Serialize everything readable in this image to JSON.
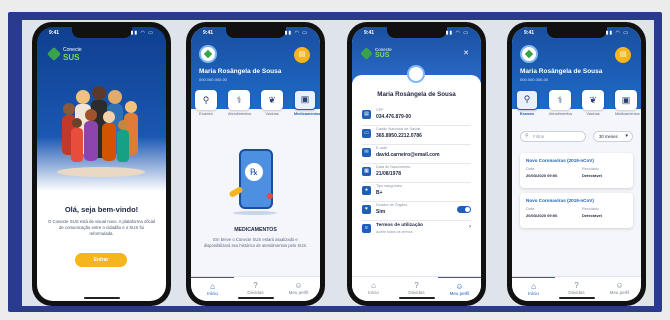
{
  "status_time": "9:41",
  "phone1": {
    "logo_line1": "Conecte",
    "logo_line2": "SUS",
    "welcome": "Olá, seja bem-vindo!",
    "message": "O Conecte SUS está de visual novo. A plataforma oficial de comunicação entre o cidadão e o SUS foi reformulada.",
    "button": "Entrar"
  },
  "phone2": {
    "name": "Maria Rosângela de Sousa",
    "cpf": "000.000.000-00",
    "services": [
      {
        "label": "Exames",
        "icon": "microscope-icon"
      },
      {
        "label": "Atendimentos",
        "icon": "stethoscope-icon"
      },
      {
        "label": "Vacinas",
        "icon": "leaf-icon"
      },
      {
        "label": "Medicamentos",
        "icon": "pill-bottle-icon"
      }
    ],
    "section_title": "MEDICAMENTOS",
    "section_text": "Em breve o Conecte SUS estará atualizado e disponibilizará seu histórico de atendimentos pelo SUS."
  },
  "phone3": {
    "logo_line1": "Conecte",
    "logo_line2": "SUS",
    "name": "Maria Rosângela de Sousa",
    "fields": [
      {
        "label": "CPF",
        "value": "034.476.879-00",
        "icon": "id-card-icon"
      },
      {
        "label": "Cartão Nacional de Saúde",
        "value": "365.8950.2212.0786",
        "icon": "card-icon"
      },
      {
        "label": "E-mail",
        "value": "david.carneiro@email.com",
        "icon": "mail-icon"
      },
      {
        "label": "Data de Nascimento",
        "value": "21/08/1978",
        "icon": "calendar-icon"
      },
      {
        "label": "Tipo sanguíneo",
        "value": "B+",
        "icon": "drop-icon"
      },
      {
        "label": "Doador de Órgãos",
        "value": "Sim",
        "icon": "heart-icon"
      }
    ],
    "terms_title": "Termos de utilização",
    "terms_sub": "Aceite todos os termos"
  },
  "phone4": {
    "name": "Maria Rosângela de Sousa",
    "cpf": "000.000.000-00",
    "services": [
      {
        "label": "Exames",
        "icon": "microscope-icon"
      },
      {
        "label": "Atendimentos",
        "icon": "stethoscope-icon"
      },
      {
        "label": "Vacinas",
        "icon": "leaf-icon"
      },
      {
        "label": "Medicamentos",
        "icon": "pill-bottle-icon"
      }
    ],
    "filter_placeholder": "Filtrar",
    "period": "30 meses",
    "results": [
      {
        "title": "Novo Coronavírus (2019-nCoV)",
        "date_label": "Data",
        "date": "20/03/2020 09:06",
        "result_label": "Resultado",
        "result": "Detectável"
      },
      {
        "title": "Novo Coronavírus (2019-nCoV)",
        "date_label": "Data",
        "date": "20/03/2020 09:06",
        "result_label": "Resultado",
        "result": "Detectável"
      }
    ]
  },
  "nav": [
    "Início",
    "Dúvidas",
    "Meu perfil"
  ],
  "colors": {
    "primary": "#1e5fb8",
    "accent": "#f7b51d",
    "frame": "#2a3a8c"
  }
}
